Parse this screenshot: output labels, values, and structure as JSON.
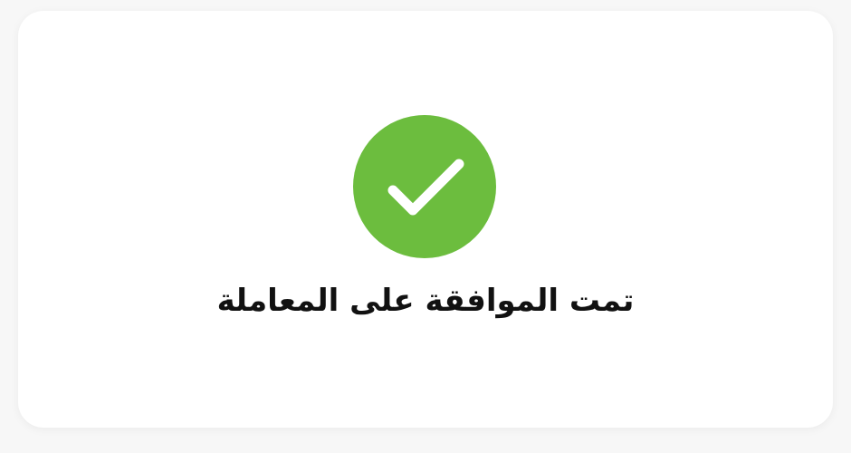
{
  "status": {
    "icon": "check-circle-icon",
    "icon_color": "#6cbd3e",
    "message": "تمت الموافقة على المعاملة"
  }
}
